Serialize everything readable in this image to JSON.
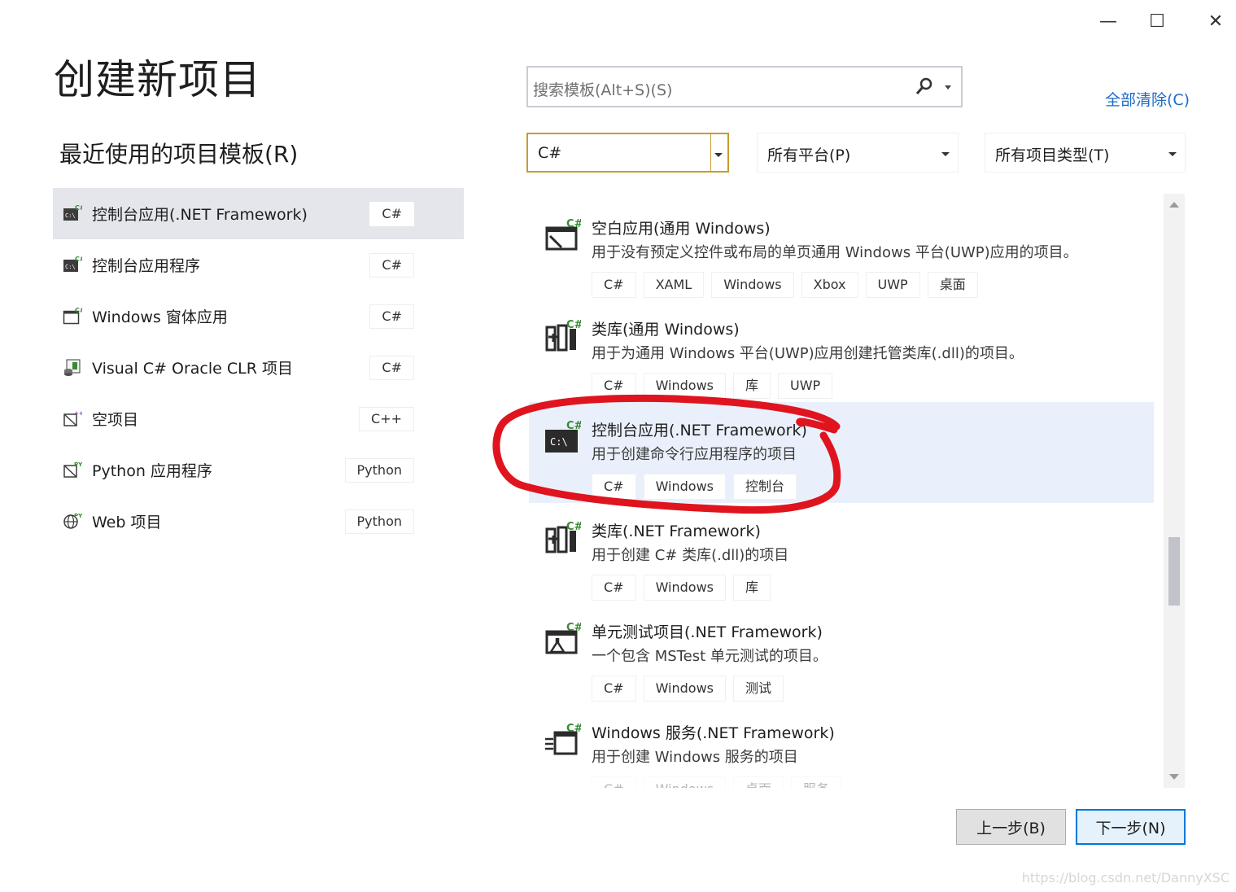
{
  "window": {
    "minimize_glyph": "—",
    "maximize_glyph": "☐",
    "close_glyph": "✕"
  },
  "page_title": "创建新项目",
  "recent": {
    "title": "最近使用的项目模板(R)",
    "items": [
      {
        "label": "控制台应用(.NET Framework)",
        "lang": "C#",
        "icon": "console-app-icon",
        "selected": true
      },
      {
        "label": "控制台应用程序",
        "lang": "C#",
        "icon": "console-app-icon"
      },
      {
        "label": "Windows 窗体应用",
        "lang": "C#",
        "icon": "windows-form-icon"
      },
      {
        "label": "Visual C# Oracle CLR 项目",
        "lang": "C#",
        "icon": "oracle-clr-icon"
      },
      {
        "label": "空项目",
        "lang": "C++",
        "icon": "empty-project-icon"
      },
      {
        "label": "Python 应用程序",
        "lang": "Python",
        "icon": "python-app-icon"
      },
      {
        "label": "Web 项目",
        "lang": "Python",
        "icon": "web-project-icon"
      }
    ]
  },
  "search": {
    "placeholder": "搜索模板(Alt+S)(S)"
  },
  "clear_all": "全部清除(C)",
  "filters": {
    "language": "C#",
    "platform": "所有平台(P)",
    "project_type": "所有项目类型(T)"
  },
  "templates": [
    {
      "name": "空白应用(通用 Windows)",
      "desc": "用于没有预定义控件或布局的单页通用 Windows 平台(UWP)应用的项目。",
      "tags": [
        "C#",
        "XAML",
        "Windows",
        "Xbox",
        "UWP",
        "桌面"
      ],
      "icon": "blank-app-icon"
    },
    {
      "name": "类库(通用 Windows)",
      "desc": "用于为通用 Windows 平台(UWP)应用创建托管类库(.dll)的项目。",
      "tags": [
        "C#",
        "Windows",
        "库",
        "UWP"
      ],
      "icon": "class-library-icon"
    },
    {
      "name": "控制台应用(.NET Framework)",
      "desc": "用于创建命令行应用程序的项目",
      "tags": [
        "C#",
        "Windows",
        "控制台"
      ],
      "icon": "console-app-icon",
      "selected": true
    },
    {
      "name": "类库(.NET Framework)",
      "desc": "用于创建 C# 类库(.dll)的项目",
      "tags": [
        "C#",
        "Windows",
        "库"
      ],
      "icon": "class-library-icon"
    },
    {
      "name": "单元测试项目(.NET Framework)",
      "desc": "一个包含 MSTest 单元测试的项目。",
      "tags": [
        "C#",
        "Windows",
        "测试"
      ],
      "icon": "unit-test-icon"
    },
    {
      "name": "Windows 服务(.NET Framework)",
      "desc": "用于创建 Windows 服务的项目",
      "tags": [
        "C#",
        "Windows",
        "桌面",
        "服务"
      ],
      "icon": "windows-service-icon"
    }
  ],
  "buttons": {
    "back": "上一步(B)",
    "next": "下一步(N)"
  },
  "watermark": "https://blog.csdn.net/DannyXSC",
  "colors": {
    "accent_blue": "#0078d7",
    "link_blue": "#1b6ac9",
    "filter_border_gold": "#c79b2e",
    "selected_bg": "#e9f0fb",
    "annotation_red": "#e0141e",
    "csharp_green": "#388a34"
  }
}
